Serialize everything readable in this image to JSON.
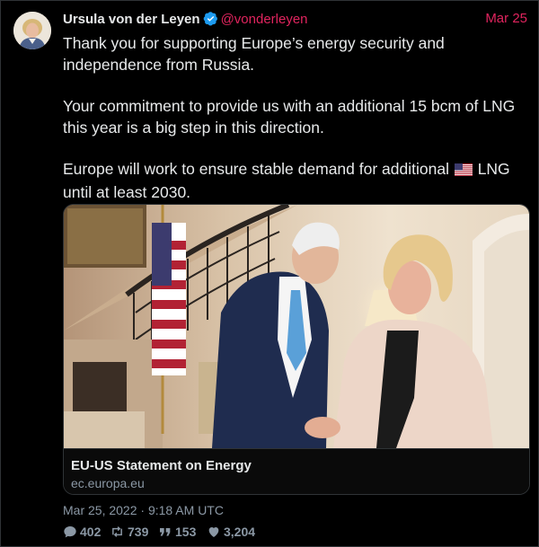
{
  "tweet": {
    "author_name": "Ursula von der Leyen",
    "handle": "@vonderleyen",
    "date": "Mar 25",
    "paragraphs": [
      "Thank you for supporting Europe’s energy security and independence from Russia.",
      "Your commitment to provide us with an additional 15 bcm of LNG this year is a big step in this direction."
    ],
    "p3_before": "Europe will work to ensure stable demand for additional ",
    "p3_after": " LNG until at least 2030.",
    "timestamp": "Mar 25, 2022 · 9:18 AM UTC"
  },
  "card": {
    "title": "EU-US Statement on Energy",
    "domain": "ec.europa.eu"
  },
  "stats": {
    "replies": "402",
    "retweets": "739",
    "quotes": "153",
    "likes": "3,204"
  },
  "icons": {
    "verified": "verified-badge-icon",
    "flag": "us-flag-emoji",
    "reply": "comment-icon",
    "retweet": "retweet-icon",
    "quote": "quote-icon",
    "like": "heart-icon"
  },
  "colors": {
    "background": "#000000",
    "text": "#e7e9ea",
    "accent_handle": "#e0245e",
    "muted": "#8b98a5",
    "verified": "#1d9bf0"
  }
}
